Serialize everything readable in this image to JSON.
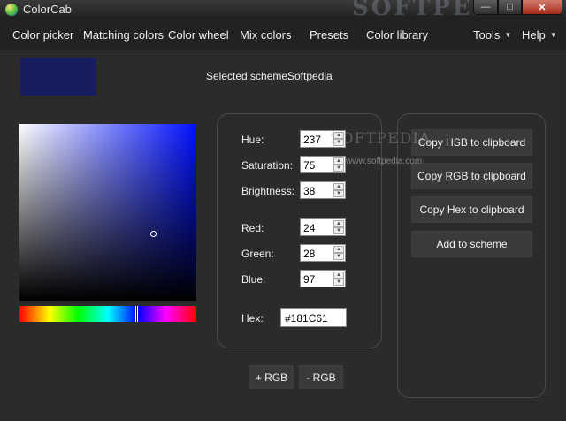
{
  "window": {
    "title": "ColorCab",
    "watermark": "SOFTPEDIA"
  },
  "menu": {
    "items": [
      "Color picker",
      "Matching colors",
      "Color wheel",
      "Mix colors",
      "Presets",
      "Color library"
    ],
    "tools": "Tools",
    "help": "Help"
  },
  "scheme": {
    "label": "Selected scheme:",
    "name": "Softpedia"
  },
  "colors": {
    "selected": "#181C61"
  },
  "fields": {
    "hue": {
      "label": "Hue:",
      "value": "237"
    },
    "saturation": {
      "label": "Saturation:",
      "value": "75"
    },
    "brightness": {
      "label": "Brightness:",
      "value": "38"
    },
    "red": {
      "label": "Red:",
      "value": "24"
    },
    "green": {
      "label": "Green:",
      "value": "28"
    },
    "blue": {
      "label": "Blue:",
      "value": "97"
    },
    "hex": {
      "label": "Hex:",
      "value": "#181C61"
    }
  },
  "buttons": {
    "copy_hsb": "Copy HSB to clipboard",
    "copy_rgb": "Copy RGB to clipboard",
    "copy_hex": "Copy Hex to clipboard",
    "add_scheme": "Add to scheme",
    "plus_rgb": "+ RGB",
    "minus_rgb": "- RGB"
  },
  "watermark": {
    "center": "SOFTPEDIA",
    "url": "www.softpedia.com"
  }
}
